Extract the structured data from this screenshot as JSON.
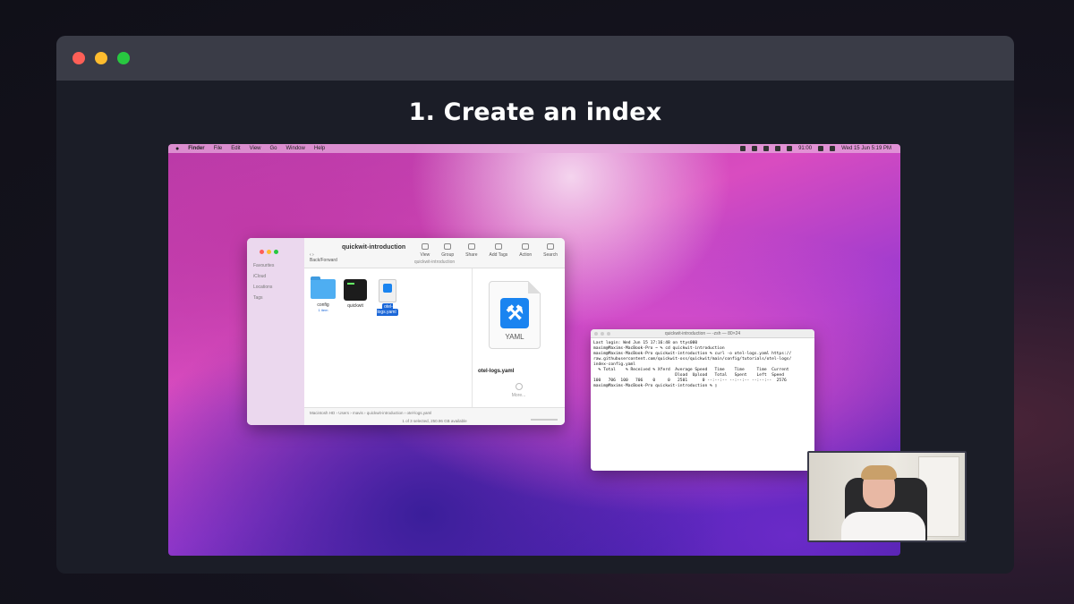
{
  "slide": {
    "title": "1. Create an index"
  },
  "menubar": {
    "app": "Finder",
    "items": [
      "File",
      "Edit",
      "View",
      "Go",
      "Window",
      "Help"
    ],
    "clock": "Wed 15 Jun  5:19 PM",
    "battery": "91:00"
  },
  "finder": {
    "title": "quickwit-introduction",
    "back_label": "Back/Forward",
    "path_label": "quickwit-introduction",
    "sidebar": [
      "Favourites",
      "iCloud",
      "Locations",
      "Tags"
    ],
    "tools": [
      "View",
      "Group",
      "Share",
      "Add Tags",
      "Action",
      "Search"
    ],
    "items": [
      {
        "name": "config",
        "sub": "1 item"
      },
      {
        "name": "quickwit",
        "sub": ""
      },
      {
        "name": "otel-logs.yaml",
        "sub": ""
      }
    ],
    "preview": {
      "icon_label": "YAML",
      "name": "otel-logs.yaml",
      "more": "More..."
    },
    "status_path": "Macintosh HD › Users › mavis › quickwit-introduction › otel-logs.yaml",
    "status_text": "1 of 3 selected, 250.96 GB available"
  },
  "terminal": {
    "title": "quickwit-introduction — -zsh — 80×24",
    "lines": [
      "Last login: Wed Jun 15 17:16:48 on ttys000",
      "maxim@Maxims-MacBook-Pro ~ % cd quickwit-introduction",
      "maxim@Maxims-MacBook-Pro quickwit-introduction % curl -o otel-logs.yaml https://",
      "raw.githubusercontent.com/quickwit-oss/quickwit/main/config/tutorials/otel-logs/",
      "index-config.yaml",
      "  % Total    % Received % Xferd  Average Speed   Time    Time     Time  Current",
      "                                 Dload  Upload   Total   Spent    Left  Speed",
      "100   706  100   706    0     0   2501      0 --:--:-- --:--:-- --:--:--  2576",
      "maxim@Maxims-MacBook-Pro quickwit-introduction % ▯"
    ]
  },
  "colors": {
    "frame_bar": "#3a3c47",
    "frame_bg": "#1b1d27",
    "traffic_red": "#fe5f57",
    "traffic_yellow": "#febc2e",
    "traffic_green": "#28c840",
    "selection": "#1b67d8"
  }
}
